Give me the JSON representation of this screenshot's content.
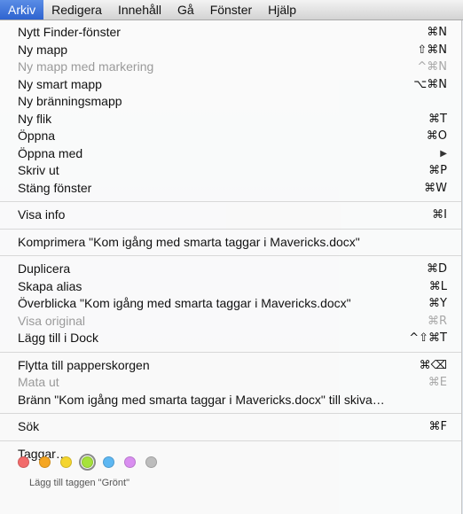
{
  "menubar": {
    "items": [
      {
        "label": "Arkiv"
      },
      {
        "label": "Redigera"
      },
      {
        "label": "Innehåll"
      },
      {
        "label": "Gå"
      },
      {
        "label": "Fönster"
      },
      {
        "label": "Hjälp"
      }
    ]
  },
  "menu": {
    "g1": [
      {
        "label": "Nytt Finder-fönster",
        "shortcut": "⌘N"
      },
      {
        "label": "Ny mapp",
        "shortcut": "⇧⌘N"
      },
      {
        "label": "Ny mapp med markering",
        "shortcut": "^⌘N"
      },
      {
        "label": "Ny smart mapp",
        "shortcut": "⌥⌘N"
      },
      {
        "label": "Ny bränningsmapp",
        "shortcut": ""
      },
      {
        "label": "Ny flik",
        "shortcut": "⌘T"
      },
      {
        "label": "Öppna",
        "shortcut": "⌘O"
      },
      {
        "label": "Öppna med",
        "shortcut": "▶"
      },
      {
        "label": "Skriv ut",
        "shortcut": "⌘P"
      },
      {
        "label": "Stäng fönster",
        "shortcut": "⌘W"
      }
    ],
    "g2": [
      {
        "label": "Visa info",
        "shortcut": "⌘I"
      }
    ],
    "g3": [
      {
        "label": "Komprimera \"Kom igång med smarta taggar i Mavericks.docx\"",
        "shortcut": ""
      }
    ],
    "g4": [
      {
        "label": "Duplicera",
        "shortcut": "⌘D"
      },
      {
        "label": "Skapa alias",
        "shortcut": "⌘L"
      },
      {
        "label": "Överblicka \"Kom igång med smarta taggar i Mavericks.docx\"",
        "shortcut": "⌘Y"
      },
      {
        "label": "Visa original",
        "shortcut": "⌘R"
      },
      {
        "label": "Lägg till i Dock",
        "shortcut": "^⇧⌘T"
      }
    ],
    "g5": [
      {
        "label": "Flytta till papperskorgen",
        "shortcut": "⌘⌫"
      },
      {
        "label": "Mata ut",
        "shortcut": "⌘E"
      },
      {
        "label": "Bränn \"Kom igång med smarta taggar i Mavericks.docx\" till skiva…",
        "shortcut": ""
      }
    ],
    "g6": [
      {
        "label": "Sök",
        "shortcut": "⌘F"
      }
    ],
    "g7": [
      {
        "label": "Taggar…",
        "shortcut": ""
      }
    ]
  },
  "tags": {
    "colors": [
      "#f26b6b",
      "#f5a623",
      "#f4d52e",
      "#a6e23a",
      "#5db7f2",
      "#d98ef0",
      "#bdbdbd"
    ],
    "selected_index": 3,
    "hint": "Lägg till taggen \"Grönt\""
  }
}
